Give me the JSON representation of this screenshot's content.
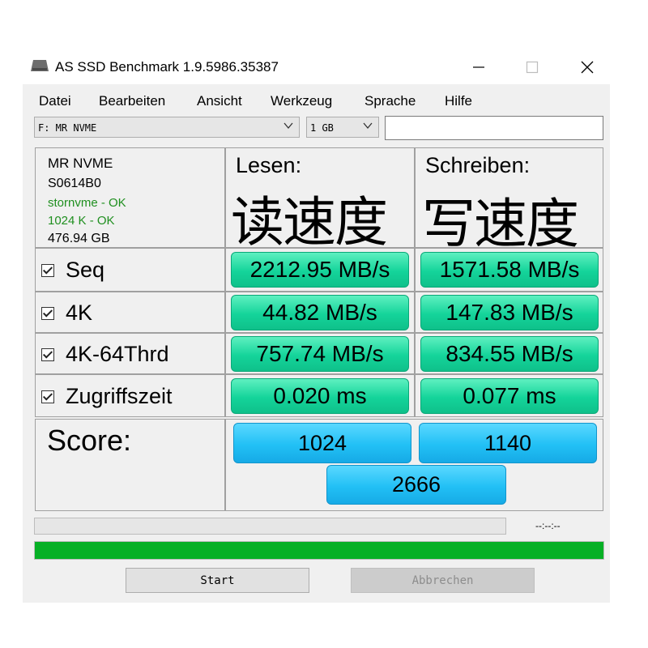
{
  "window": {
    "title": "AS SSD Benchmark 1.9.5986.35387",
    "minimize": "—",
    "maximize": "☐",
    "close": "✕"
  },
  "menu": [
    "Datei",
    "Bearbeiten",
    "Ansicht",
    "Werkzeug",
    "Sprache",
    "Hilfe"
  ],
  "drive_select": {
    "value": "F: MR NVME"
  },
  "size_select": {
    "value": "1 GB"
  },
  "info": {
    "name": "MR NVME",
    "firmware": "S0614B0",
    "driver": "stornvme - OK",
    "alignment": "1024 K - OK",
    "capacity": "476.94 GB"
  },
  "headers": {
    "read_label": "Lesen:",
    "write_label": "Schreiben:",
    "read_overlay": "读速度",
    "write_overlay": "写速度"
  },
  "rows": [
    {
      "label": "Seq",
      "read": "2212.95 MB/s",
      "write": "1571.58 MB/s",
      "checked": true
    },
    {
      "label": "4K",
      "read": "44.82 MB/s",
      "write": "147.83 MB/s",
      "checked": true
    },
    {
      "label": "4K-64Thrd",
      "read": "757.74 MB/s",
      "write": "834.55 MB/s",
      "checked": true
    },
    {
      "label": "Zugriffszeit",
      "read": "0.020 ms",
      "write": "0.077 ms",
      "checked": true
    }
  ],
  "score": {
    "label": "Score:",
    "read": "1024",
    "write": "1140",
    "total": "2666"
  },
  "progress": {
    "timer": "--:--:--",
    "bar_fraction": 1.0,
    "bar_color": "#06b025"
  },
  "buttons": {
    "start": "Start",
    "abort": "Abbrechen"
  },
  "colors": {
    "result_green": "#14d49a",
    "score_blue": "#22c0f5",
    "ok_green": "#1f8f1f"
  }
}
